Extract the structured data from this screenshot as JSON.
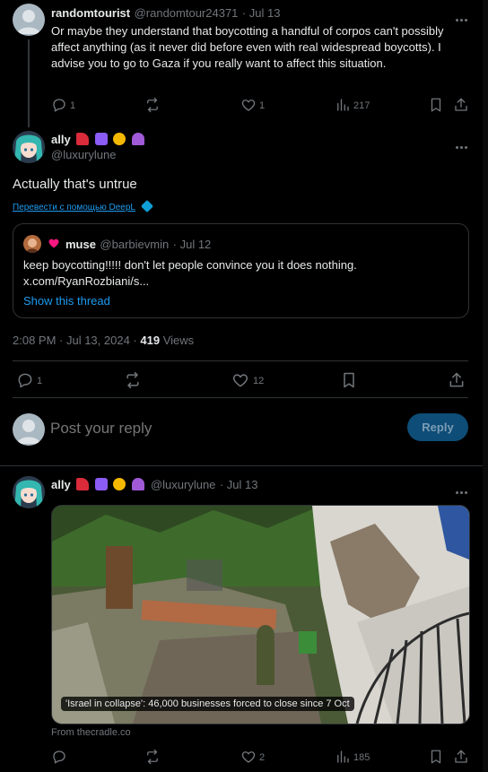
{
  "post1": {
    "name": "randomtourist",
    "handle": "@randomtour24371",
    "date": "· Jul 13",
    "text": "Or maybe they understand that boycotting a handful of corpos can't possibly affect anything (as it never did before even with real widespread boycotts). I advise you to go to Gaza if you really want to affect this situation.",
    "replies": "1",
    "likes": "1",
    "views": "217"
  },
  "main": {
    "name": "ally",
    "handle": "@luxurylune",
    "text": "Actually that's untrue",
    "translate": "Перевести с помощью DeepL",
    "quote": {
      "name": "muse",
      "handle": "@barbievmin",
      "date": "· Jul 12",
      "text": "keep boycotting!!!!! don't let people convince you it does nothing.",
      "url": "x.com/RyanRozbiani/s...",
      "show_thread": "Show this thread"
    },
    "timestamp": "2:08 PM · Jul 13, 2024 ·",
    "views_count": "419",
    "views_label": "Views",
    "replies": "1",
    "likes": "12"
  },
  "reply_box": {
    "placeholder": "Post your reply",
    "button": "Reply"
  },
  "post3": {
    "name": "ally",
    "handle": "@luxurylune",
    "date": "· Jul 13",
    "card_title": "'Israel in collapse': 46,000 businesses forced to close since 7 Oct",
    "card_source": "From thecradle.co",
    "likes": "2",
    "views": "185"
  },
  "colors": {
    "background": "#000000",
    "text": "#e7e9ea",
    "muted": "#71767b",
    "accent": "#1d9bf0",
    "heart_emoji": "#f91880"
  },
  "icons": [
    "reply-icon",
    "repost-icon",
    "like-icon",
    "views-icon",
    "bookmark-icon",
    "share-icon",
    "more-icon",
    "deepl-icon"
  ]
}
